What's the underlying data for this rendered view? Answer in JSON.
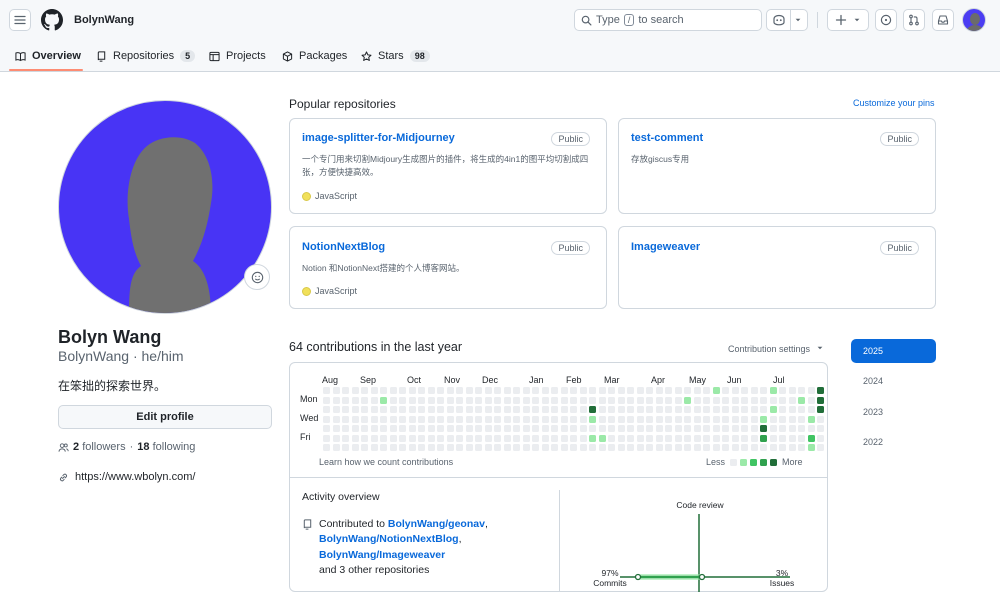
{
  "header": {
    "owner": "BolynWang",
    "search_prefix": "Type",
    "search_key": "/",
    "search_suffix": "to search"
  },
  "tabs": [
    {
      "label": "Overview",
      "count": null,
      "icon": "book-icon"
    },
    {
      "label": "Repositories",
      "count": "5",
      "icon": "repo-icon"
    },
    {
      "label": "Projects",
      "count": null,
      "icon": "table-icon"
    },
    {
      "label": "Packages",
      "count": null,
      "icon": "package-icon"
    },
    {
      "label": "Stars",
      "count": "98",
      "icon": "star-icon"
    }
  ],
  "profile": {
    "full_name": "Bolyn Wang",
    "username_line": "BolynWang · he/him",
    "bio": "在笨拙的探索世界。",
    "edit_label": "Edit profile",
    "followers_count": "2",
    "followers_label": "followers",
    "following_count": "18",
    "following_label": "following",
    "website": "https://www.wbolyn.com/"
  },
  "popular": {
    "title": "Popular repositories",
    "customize": "Customize your pins",
    "repos": [
      {
        "name": "image-splitter-for-Midjourney",
        "badge": "Public",
        "desc": "一个专门用来切割Midjoury生成图片的插件，将生成的4in1的图平均切割成四张，方便快捷高效。",
        "lang": "JavaScript"
      },
      {
        "name": "test-comment",
        "badge": "Public",
        "desc": "存放giscus专用",
        "lang": ""
      },
      {
        "name": "NotionNextBlog",
        "badge": "Public",
        "desc": "Notion 和NotionNext搭建的个人博客网站。",
        "lang": "JavaScript"
      },
      {
        "name": "Imageweaver",
        "badge": "Public",
        "desc": "",
        "lang": ""
      }
    ]
  },
  "contributions": {
    "title": "64 contributions in the last year",
    "settings": "Contribution settings",
    "months": [
      "Aug",
      "Sep",
      "Oct",
      "Nov",
      "Dec",
      "Jan",
      "Feb",
      "Mar",
      "Apr",
      "May",
      "Jun",
      "Jul"
    ],
    "days": [
      "Mon",
      "Wed",
      "Fri"
    ],
    "learn": "Learn how we count contributions",
    "less": "Less",
    "more": "More",
    "colors": {
      "empty": "#ebedf0",
      "l1": "#9be9a8",
      "l2": "#40c463",
      "l3": "#30a14e",
      "l4": "#216e39"
    }
  },
  "years": [
    "2025",
    "2024",
    "2023",
    "2022"
  ],
  "activity": {
    "title": "Activity overview",
    "contributed_to": "Contributed to",
    "repos": [
      "BolynWang/geonav",
      "BolynWang/NotionNextBlog",
      "BolynWang/Imageweaver"
    ],
    "others": "and 3 other repositories",
    "code_review": "Code review",
    "commits_pct": "97%",
    "commits_label": "Commits",
    "issues_pct": "3%",
    "issues_label": "Issues"
  }
}
